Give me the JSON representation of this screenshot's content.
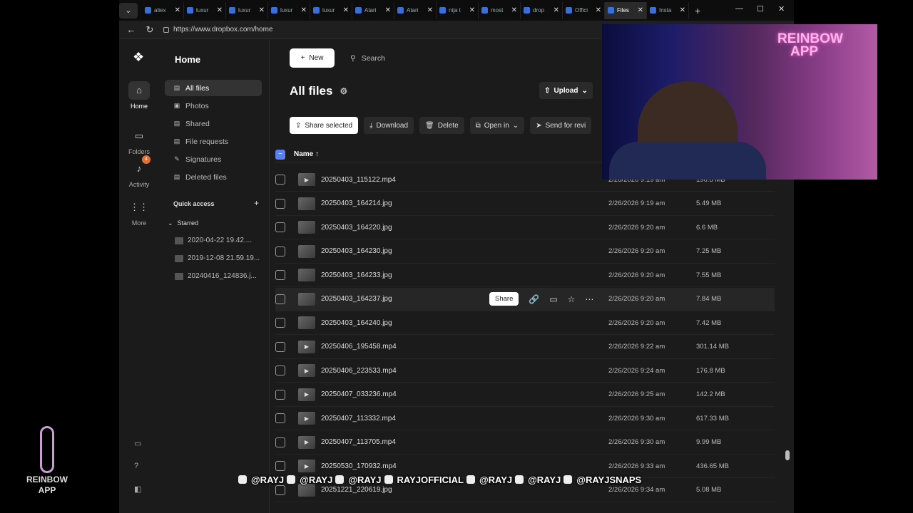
{
  "browser": {
    "tabs": [
      {
        "label": "aliex",
        "active": false
      },
      {
        "label": "luxur",
        "active": false
      },
      {
        "label": "luxur",
        "active": false
      },
      {
        "label": "luxur",
        "active": false
      },
      {
        "label": "luxur",
        "active": false
      },
      {
        "label": "Atari",
        "active": false
      },
      {
        "label": "Atari",
        "active": false
      },
      {
        "label": "nija t",
        "active": false
      },
      {
        "label": "most",
        "active": false
      },
      {
        "label": "drop",
        "active": false
      },
      {
        "label": "Offici",
        "active": false
      },
      {
        "label": "Files",
        "active": true
      },
      {
        "label": "Insta",
        "active": false
      }
    ],
    "url": "https://www.dropbox.com/home"
  },
  "rail": {
    "items": [
      {
        "label": "Home",
        "icon": "home-icon"
      },
      {
        "label": "Folders",
        "icon": "folder-icon"
      },
      {
        "label": "Activity",
        "icon": "bell-icon",
        "badge": "4"
      },
      {
        "label": "More",
        "icon": "grid-icon"
      }
    ]
  },
  "sidebar": {
    "title": "Home",
    "items": [
      {
        "label": "All files",
        "icon": "all-files-icon"
      },
      {
        "label": "Photos",
        "icon": "photos-icon"
      },
      {
        "label": "Shared",
        "icon": "shared-icon"
      },
      {
        "label": "File requests",
        "icon": "file-requests-icon"
      },
      {
        "label": "Signatures",
        "icon": "signatures-icon"
      },
      {
        "label": "Deleted files",
        "icon": "deleted-files-icon"
      }
    ],
    "quick_access": "Quick access",
    "starred": "Starred",
    "starred_items": [
      "2020-04-22 19.42....",
      "2019-12-08 21.59.19...",
      "20240416_124836.j..."
    ]
  },
  "main": {
    "new_label": "New",
    "search_placeholder": "Search",
    "page_title": "All files",
    "upload_label": "Upload",
    "actions": [
      "Share selected",
      "Download",
      "Delete",
      "Open in",
      "Send for revi"
    ],
    "col_name": "Name",
    "share_label": "Share",
    "rows": [
      {
        "name": "20250403_115122.mp4",
        "modified": "2/26/2026 9:19 am",
        "size": "190.8 MB"
      },
      {
        "name": "20250403_164214.jpg",
        "modified": "2/26/2026 9:19 am",
        "size": "5.49 MB"
      },
      {
        "name": "20250403_164220.jpg",
        "modified": "2/26/2026 9:20 am",
        "size": "6.6 MB"
      },
      {
        "name": "20250403_164230.jpg",
        "modified": "2/26/2026 9:20 am",
        "size": "7.25 MB"
      },
      {
        "name": "20250403_164233.jpg",
        "modified": "2/26/2026 9:20 am",
        "size": "7.55 MB"
      },
      {
        "name": "20250403_164237.jpg",
        "modified": "2/26/2026 9:20 am",
        "size": "7.84 MB"
      },
      {
        "name": "20250403_164240.jpg",
        "modified": "2/26/2026 9:20 am",
        "size": "7.42 MB"
      },
      {
        "name": "20250406_195458.mp4",
        "modified": "2/26/2026 9:22 am",
        "size": "301.14 MB"
      },
      {
        "name": "20250406_223533.mp4",
        "modified": "2/26/2026 9:24 am",
        "size": "176.8 MB"
      },
      {
        "name": "20250407_033236.mp4",
        "modified": "2/26/2026 9:25 am",
        "size": "142.2 MB"
      },
      {
        "name": "20250407_113332.mp4",
        "modified": "2/26/2026 9:30 am",
        "size": "617.33 MB"
      },
      {
        "name": "20250407_113705.mp4",
        "modified": "2/26/2026 9:30 am",
        "size": "9.99 MB"
      },
      {
        "name": "20250530_170932.mp4",
        "modified": "2/26/2026 9:33 am",
        "size": "436.65 MB"
      },
      {
        "name": "20251221_220619.jpg",
        "modified": "2/26/2026 9:34 am",
        "size": "5.08 MB"
      }
    ]
  },
  "overlay": {
    "webcam_logo_line1": "REINBOW",
    "webcam_logo_line2": "APP",
    "watermark_line1": "REINBOW",
    "watermark_line2": "APP",
    "socials": [
      "@RAYJ",
      "@RAYJ",
      "@RAYJ",
      "RAYJOFFICIAL",
      "@RAYJ",
      "@RAYJ",
      "@RAYJSNAPS"
    ]
  }
}
